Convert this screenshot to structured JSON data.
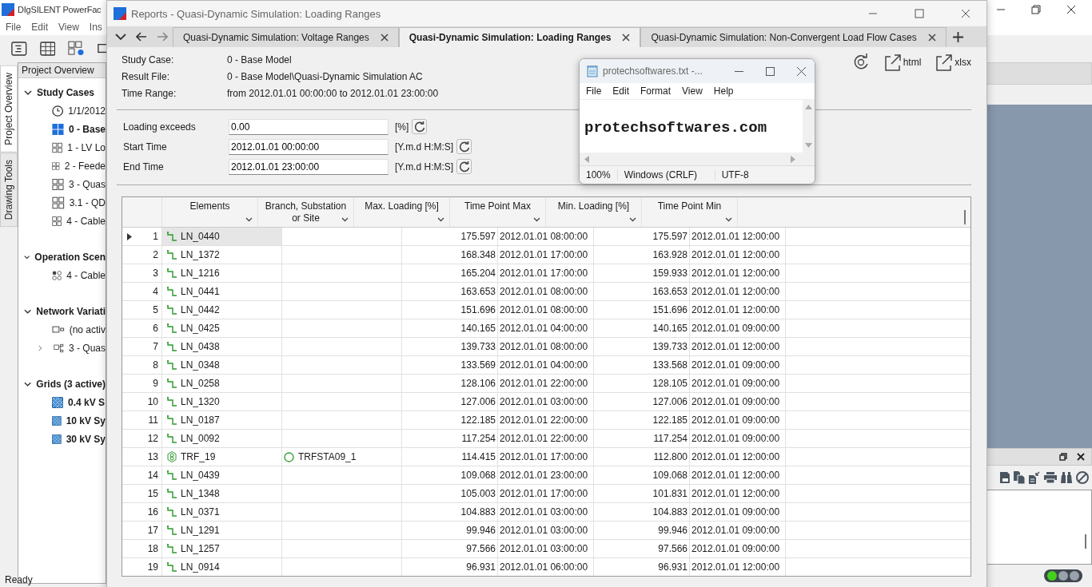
{
  "app": {
    "title": "DIgSILENT PowerFac",
    "menu": [
      "File",
      "Edit",
      "View",
      "Ins"
    ]
  },
  "side_tabs": [
    {
      "label": "Project Overview",
      "selected": true
    },
    {
      "label": "Drawing Tools",
      "selected": false
    }
  ],
  "project_overview": {
    "title": "Project Overview",
    "sections": [
      {
        "title": "Study Cases",
        "expanded": true,
        "children": [
          {
            "label": "1/1/2012",
            "kind": "clock",
            "active": false
          },
          {
            "label": "0 - Base",
            "kind": "case",
            "active": true
          },
          {
            "label": "1 - LV Lo",
            "kind": "case",
            "active": false
          },
          {
            "label": "2 - Feede",
            "kind": "case",
            "active": false
          },
          {
            "label": "3 - Quas",
            "kind": "case",
            "active": false
          },
          {
            "label": "3.1 - QD",
            "kind": "case",
            "active": false
          },
          {
            "label": "4 - Cable",
            "kind": "case",
            "active": false
          }
        ]
      },
      {
        "title": "Operation Scen",
        "expanded": true,
        "children": [
          {
            "label": "4 - Cable",
            "kind": "scenario",
            "active": false
          }
        ]
      },
      {
        "title": "Network Variati",
        "expanded": true,
        "children": [
          {
            "label": "(no activ",
            "kind": "variation",
            "active": false
          },
          {
            "label": "3 - Quas",
            "kind": "variation_group",
            "active": false
          }
        ]
      },
      {
        "title": "Grids (3 active)",
        "expanded": true,
        "children": [
          {
            "label": "0.4 kV S",
            "kind": "grid",
            "active": true
          },
          {
            "label": "10 kV Sy",
            "kind": "grid",
            "active": true
          },
          {
            "label": "30 kV Sy",
            "kind": "grid",
            "active": true
          }
        ]
      }
    ]
  },
  "report": {
    "title": "Reports - Quasi-Dynamic Simulation: Loading Ranges",
    "tabs": [
      {
        "label": "Quasi-Dynamic Simulation: Voltage Ranges",
        "selected": false
      },
      {
        "label": "Quasi-Dynamic Simulation: Loading Ranges",
        "selected": true
      },
      {
        "label": "Quasi-Dynamic Simulation: Non-Convergent Load Flow Cases",
        "selected": false
      }
    ],
    "export": [
      "html",
      "xlsx"
    ],
    "info": [
      {
        "label": "Study Case:",
        "value": "0 - Base Model"
      },
      {
        "label": "Result File:",
        "value": "0 - Base Model\\Quasi-Dynamic Simulation AC"
      },
      {
        "label": "Time Range:",
        "value": "from 2012.01.01 00:00:00 to 2012.01.01 23:00:00"
      }
    ],
    "filters": [
      {
        "label": "Loading exceeds",
        "value": "0.00",
        "unit": "[%]"
      },
      {
        "label": "Start Time",
        "value": "2012.01.01 00:00:00",
        "unit": "[Y.m.d H:M:S]"
      },
      {
        "label": "End Time",
        "value": "2012.01.01 23:00:00",
        "unit": "[Y.m.d H:M:S]"
      }
    ],
    "table": {
      "columns": [
        "Elements",
        "Branch, Substation or Site",
        "Max. Loading [%]",
        "Time Point Max",
        "Min. Loading [%]",
        "Time Point Min"
      ],
      "rows": [
        {
          "n": "1",
          "element": "LN_0440",
          "kind": "line",
          "max": "175.597",
          "tmax": "2012.01.01 08:00:00",
          "min": "175.597",
          "tmin": "2012.01.01 12:00:00",
          "selected": true
        },
        {
          "n": "2",
          "element": "LN_1372",
          "kind": "line",
          "max": "168.348",
          "tmax": "2012.01.01 17:00:00",
          "min": "163.928",
          "tmin": "2012.01.01 12:00:00",
          "selected": false
        },
        {
          "n": "3",
          "element": "LN_1216",
          "kind": "line",
          "max": "165.204",
          "tmax": "2012.01.01 17:00:00",
          "min": "159.933",
          "tmin": "2012.01.01 12:00:00",
          "selected": false
        },
        {
          "n": "4",
          "element": "LN_0441",
          "kind": "line",
          "max": "163.653",
          "tmax": "2012.01.01 08:00:00",
          "min": "163.653",
          "tmin": "2012.01.01 12:00:00",
          "selected": false
        },
        {
          "n": "5",
          "element": "LN_0442",
          "kind": "line",
          "max": "151.696",
          "tmax": "2012.01.01 08:00:00",
          "min": "151.696",
          "tmin": "2012.01.01 12:00:00",
          "selected": false
        },
        {
          "n": "6",
          "element": "LN_0425",
          "kind": "line",
          "max": "140.165",
          "tmax": "2012.01.01 04:00:00",
          "min": "140.165",
          "tmin": "2012.01.01 09:00:00",
          "selected": false
        },
        {
          "n": "7",
          "element": "LN_0438",
          "kind": "line",
          "max": "139.733",
          "tmax": "2012.01.01 08:00:00",
          "min": "139.733",
          "tmin": "2012.01.01 12:00:00",
          "selected": false
        },
        {
          "n": "8",
          "element": "LN_0348",
          "kind": "line",
          "max": "133.569",
          "tmax": "2012.01.01 04:00:00",
          "min": "133.568",
          "tmin": "2012.01.01 09:00:00",
          "selected": false
        },
        {
          "n": "9",
          "element": "LN_0258",
          "kind": "line",
          "max": "128.106",
          "tmax": "2012.01.01 22:00:00",
          "min": "128.105",
          "tmin": "2012.01.01 09:00:00",
          "selected": false
        },
        {
          "n": "10",
          "element": "LN_1320",
          "kind": "line",
          "max": "127.006",
          "tmax": "2012.01.01 03:00:00",
          "min": "127.006",
          "tmin": "2012.01.01 09:00:00",
          "selected": false
        },
        {
          "n": "11",
          "element": "LN_0187",
          "kind": "line",
          "max": "122.185",
          "tmax": "2012.01.01 22:00:00",
          "min": "122.185",
          "tmin": "2012.01.01 09:00:00",
          "selected": false
        },
        {
          "n": "12",
          "element": "LN_0092",
          "kind": "line",
          "max": "117.254",
          "tmax": "2012.01.01 22:00:00",
          "min": "117.254",
          "tmin": "2012.01.01 09:00:00",
          "selected": false
        },
        {
          "n": "13",
          "element": "TRF_19",
          "kind": "transformer",
          "branch": "TRFSTA09_1",
          "max": "114.415",
          "tmax": "2012.01.01 17:00:00",
          "min": "112.800",
          "tmin": "2012.01.01 12:00:00",
          "selected": false
        },
        {
          "n": "14",
          "element": "LN_0439",
          "kind": "line",
          "max": "109.068",
          "tmax": "2012.01.01 23:00:00",
          "min": "109.068",
          "tmin": "2012.01.01 12:00:00",
          "selected": false
        },
        {
          "n": "15",
          "element": "LN_1348",
          "kind": "line",
          "max": "105.003",
          "tmax": "2012.01.01 17:00:00",
          "min": "101.831",
          "tmin": "2012.01.01 12:00:00",
          "selected": false
        },
        {
          "n": "16",
          "element": "LN_0371",
          "kind": "line",
          "max": "104.883",
          "tmax": "2012.01.01 03:00:00",
          "min": "104.883",
          "tmin": "2012.01.01 09:00:00",
          "selected": false
        },
        {
          "n": "17",
          "element": "LN_1291",
          "kind": "line",
          "max": "99.946",
          "tmax": "2012.01.01 03:00:00",
          "min": "99.946",
          "tmin": "2012.01.01 09:00:00",
          "selected": false
        },
        {
          "n": "18",
          "element": "LN_1257",
          "kind": "line",
          "max": "97.566",
          "tmax": "2012.01.01 03:00:00",
          "min": "97.566",
          "tmin": "2012.01.01 09:00:00",
          "selected": false
        },
        {
          "n": "19",
          "element": "LN_0914",
          "kind": "line",
          "max": "96.931",
          "tmax": "2012.01.01 06:00:00",
          "min": "96.931",
          "tmin": "2012.01.01 12:00:00",
          "selected": false
        }
      ]
    }
  },
  "notepad": {
    "title": "protechsoftwares.txt -...",
    "menu": [
      "File",
      "Edit",
      "Format",
      "View",
      "Help"
    ],
    "text": "protechsoftwares.com",
    "status": [
      "100%",
      "Windows (CRLF)",
      "UTF-8"
    ]
  },
  "indicator": [
    {
      "color": "#44d11a"
    },
    {
      "color": "#9aa3ab"
    },
    {
      "color": "#9aa3ab"
    }
  ],
  "status_bar": {
    "text": "Ready"
  }
}
